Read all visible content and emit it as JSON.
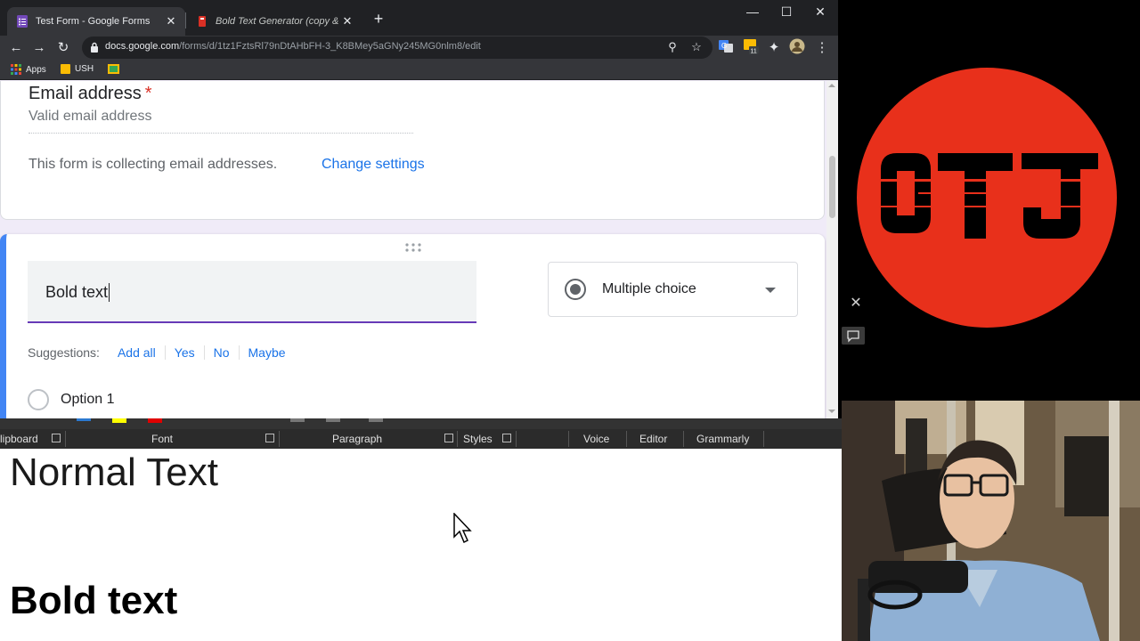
{
  "browser": {
    "tabs": [
      {
        "title": "Test Form - Google Forms",
        "active": true
      },
      {
        "title": "Bold Text Generator (copy & pas",
        "active": false
      }
    ],
    "url_host": "docs.google.com",
    "url_path": "/forms/d/1tz1FztsRl79nDtAHbFH-3_K8BMey5aGNy245MG0nlm8/edit",
    "bookmarks": [
      "Apps",
      "USH"
    ],
    "extension_badge": "11"
  },
  "form": {
    "email_card": {
      "title": "Email address",
      "required_mark": "*",
      "input_placeholder": "Valid email address",
      "collecting_text": "This form is collecting email addresses.",
      "change_settings_link": "Change settings"
    },
    "question_card": {
      "question_text": "Bold text",
      "type_label": "Multiple choice",
      "suggestions_label": "Suggestions:",
      "suggestions": [
        "Add all",
        "Yes",
        "No",
        "Maybe"
      ],
      "option1": "Option 1"
    }
  },
  "word": {
    "ribbon_groups": [
      "lipboard",
      "Font",
      "Paragraph",
      "Styles",
      "Voice",
      "Editor",
      "Grammarly"
    ],
    "normal_text": "Normal Text",
    "bold_text": "Bold text"
  },
  "colors": {
    "accent_blue": "#4285f4",
    "forms_purple": "#673ab7",
    "link_blue": "#1a73e8",
    "logo_red": "#e8301b"
  }
}
